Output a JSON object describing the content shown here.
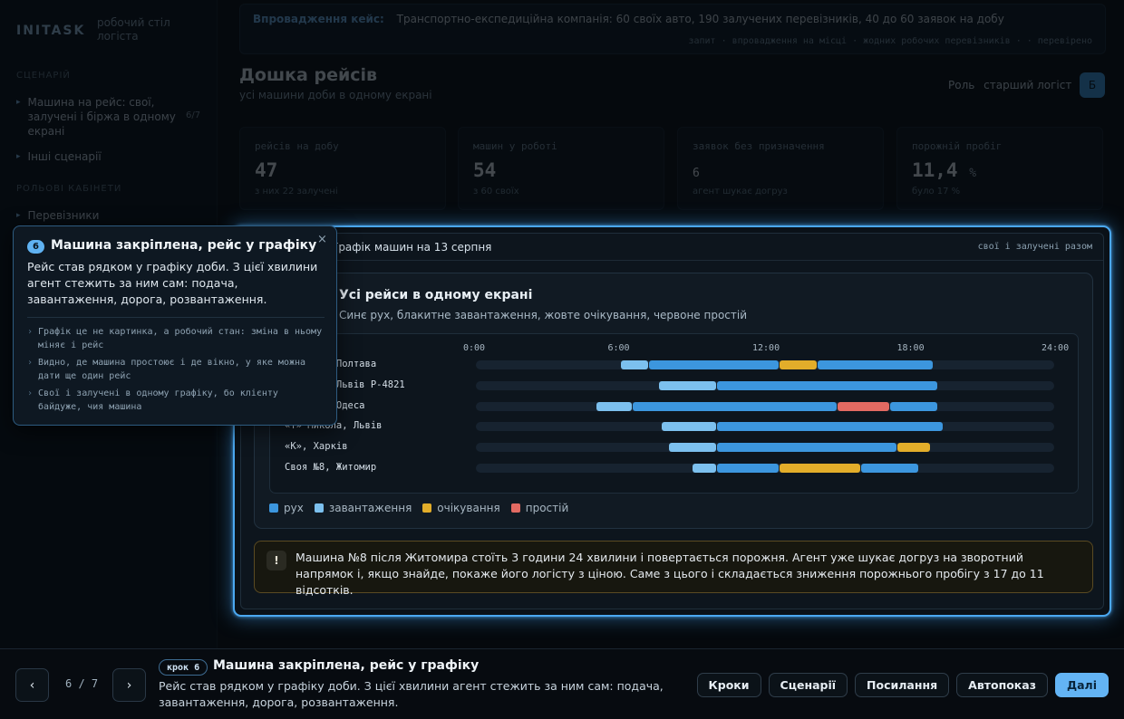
{
  "app": {
    "brand": "INITASK",
    "brand_sub": "робочий стіл логіста"
  },
  "sidebar": {
    "section_scenario": "СЦЕНАРІЙ",
    "scenario_item": "Машина на рейс: свої, залучені і біржа в одному екрані",
    "scenario_badge": "6/7",
    "other_scenarios": "Інші сценарії",
    "section_roles": "РОЛЬОВІ КАБІНЕТИ",
    "roles_item": "Перевізники"
  },
  "banner": {
    "label": "Впровадження кейс:",
    "text": "Транспортно-експедиційна компанія: 60 своїх авто, 190 залучених перевізників, 40 до 60 заявок на добу",
    "meta": "запит · впровадження на місці · жодних робочих перевізників · · перевірено"
  },
  "page": {
    "title": "Дошка рейсів",
    "subtitle": "усі машини доби в одному екрані",
    "role_label": "Роль",
    "role_value": "старший логіст",
    "role_btn": "Б"
  },
  "kpis": [
    {
      "label": "рейсів на добу",
      "value": "47",
      "unit": "",
      "note": "з них 22 залучені"
    },
    {
      "label": "машин у роботі",
      "value": "54",
      "unit": "",
      "note": "з 60 своїх"
    },
    {
      "label": "заявок без призначення",
      "value": "6",
      "unit": "",
      "note": "агент шукає догруз"
    },
    {
      "label": "порожній пробіг",
      "value": "11,4",
      "unit": "%",
      "note": "було 17 %"
    }
  ],
  "panel": {
    "title": "Графік машин на 13 серпня",
    "right": "свої і залучені разом",
    "card_title": "Усі рейси в одному екрані",
    "card_subtitle": "Синє рух, блакитне завантаження, жовте очікування, червоне простій",
    "ticks": [
      "0:00",
      "6:00",
      "12:00",
      "18:00",
      "24:00"
    ],
    "rows": [
      {
        "label": "Своя №3, Полтава",
        "segments": [
          {
            "start": 6.0,
            "end": 7.2,
            "kind": "load"
          },
          {
            "start": 7.2,
            "end": 12.6,
            "kind": "move"
          },
          {
            "start": 12.6,
            "end": 14.2,
            "kind": "wait"
          },
          {
            "start": 14.2,
            "end": 19.0,
            "kind": "move"
          }
        ]
      },
      {
        "label": "«Транс», Львів Р-4821",
        "segments": [
          {
            "start": 7.6,
            "end": 10.0,
            "kind": "load"
          },
          {
            "start": 10.0,
            "end": 19.2,
            "kind": "move"
          }
        ]
      },
      {
        "label": "Своя №1, Одеса",
        "segments": [
          {
            "start": 5.0,
            "end": 6.5,
            "kind": "load"
          },
          {
            "start": 6.5,
            "end": 15.0,
            "kind": "move"
          },
          {
            "start": 15.0,
            "end": 17.2,
            "kind": "idle"
          },
          {
            "start": 17.2,
            "end": 19.2,
            "kind": "move"
          }
        ]
      },
      {
        "label": "«Т» Микола, Львів",
        "segments": [
          {
            "start": 7.7,
            "end": 10.0,
            "kind": "load"
          },
          {
            "start": 10.0,
            "end": 19.4,
            "kind": "move"
          }
        ]
      },
      {
        "label": "«К», Харків",
        "segments": [
          {
            "start": 8.0,
            "end": 10.0,
            "kind": "load"
          },
          {
            "start": 10.0,
            "end": 17.5,
            "kind": "move"
          },
          {
            "start": 17.5,
            "end": 18.9,
            "kind": "wait"
          }
        ]
      },
      {
        "label": "Своя №8, Житомир",
        "segments": [
          {
            "start": 9.0,
            "end": 10.0,
            "kind": "load"
          },
          {
            "start": 10.0,
            "end": 12.6,
            "kind": "move"
          },
          {
            "start": 12.6,
            "end": 16.0,
            "kind": "wait"
          },
          {
            "start": 16.0,
            "end": 18.4,
            "kind": "move"
          }
        ]
      }
    ],
    "legend": [
      {
        "key": "move",
        "label": "рух",
        "color": "#3c96de"
      },
      {
        "key": "load",
        "label": "завантаження",
        "color": "#7cc0ee"
      },
      {
        "key": "wait",
        "label": "очікування",
        "color": "#e2ad2a"
      },
      {
        "key": "idle",
        "label": "простій",
        "color": "#e26a62"
      }
    ],
    "alert_icon": "!",
    "alert_text": "Машина №8 після Житомира стоїть 3 години 24 хвилини і повертається порожня. Агент уже шукає догруз на зворотний напрямок і, якщо знайде, покаже його логісту з ціною. Саме з цього і складається зниження порожнього пробігу з 17 до 11 відсотків."
  },
  "tooltip": {
    "num": "6",
    "title": "Машина закріплена, рейс у графіку",
    "close": "×",
    "text": "Рейс став рядком у графіку доби. З цієї хвилини агент стежить за ним сам: подача, завантаження, дорога, розвантаження.",
    "bullets": [
      "Графік це не картинка, а робочий стан: зміна в ньому міняє і рейс",
      "Видно, де машина простоює і де вікно, у яке можна дати ще один рейс",
      "Свої і залучені в одному графіку, бо клієнту байдуже, чия машина"
    ]
  },
  "bottom": {
    "prev": "‹",
    "next": "›",
    "counter": "6 / 7",
    "step_pill": "крок 6",
    "title": "Машина закріплена, рейс у графіку",
    "text": "Рейс став рядком у графіку доби. З цієї хвилини агент стежить за ним сам: подача, завантаження, дорога, розвантаження.",
    "actions": [
      "Кроки",
      "Сценарії",
      "Посилання",
      "Автопоказ",
      "Далі"
    ]
  }
}
